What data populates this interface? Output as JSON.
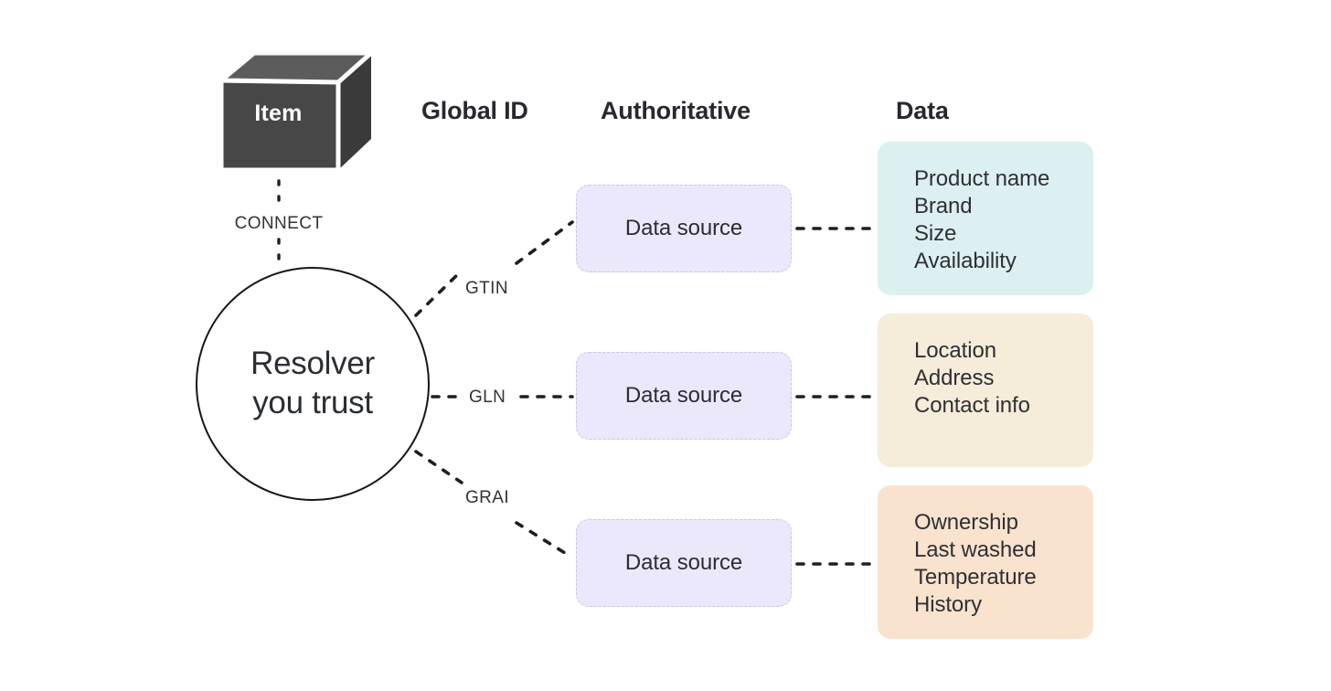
{
  "headers": {
    "global_id": "Global ID",
    "authoritative": "Authoritative",
    "data": "Data"
  },
  "item": {
    "label": "Item",
    "icon": "cube-icon"
  },
  "connect": {
    "label": "CONNECT"
  },
  "resolver": {
    "label": "Resolver\nyou trust"
  },
  "rows": [
    {
      "id_label": "GTIN",
      "source_label": "Data source",
      "panel_color": "#dcf0f1",
      "panel_items": [
        "Product name",
        "Brand",
        "Size",
        "Availability"
      ]
    },
    {
      "id_label": "GLN",
      "source_label": "Data source",
      "panel_color": "#f5ecda",
      "panel_items": [
        "Location",
        "Address",
        "Contact info"
      ]
    },
    {
      "id_label": "GRAI",
      "source_label": "Data source",
      "panel_color": "#fae3ce",
      "panel_items": [
        "Ownership",
        "Last washed",
        "Temperature",
        "History"
      ]
    }
  ],
  "colors": {
    "background": "#ffffff",
    "cube_front": "#474747",
    "cube_top": "#5c5c5c",
    "cube_side": "#3a3a3a",
    "data_source_fill": "#ebe8fb",
    "data_source_border": "#c9c5e4",
    "connector": "#1d1f22",
    "text": "#2b2e33"
  }
}
